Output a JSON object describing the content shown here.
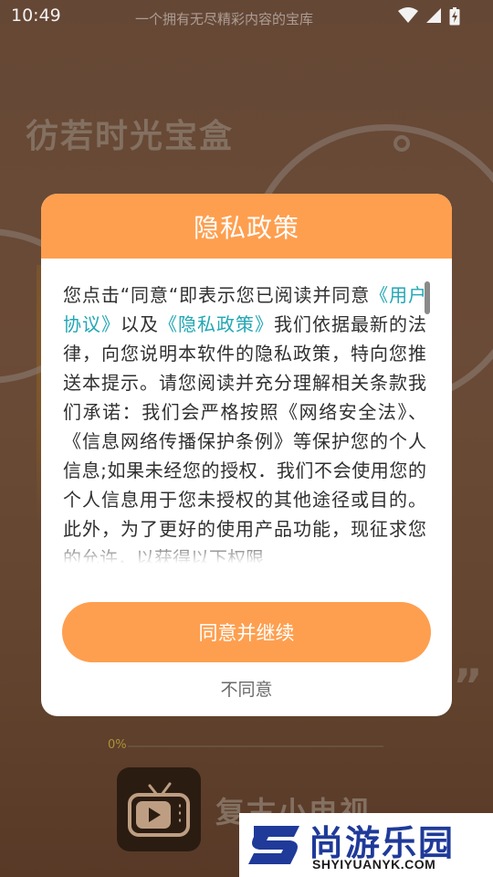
{
  "status_bar": {
    "time": "10:49",
    "center_text": "一个拥有无尽精彩内容的宝库",
    "icons": [
      "wifi-icon",
      "signal-icon",
      "battery-charging-icon"
    ]
  },
  "background": {
    "title": "彷若时光宝盒",
    "quote_mark": "”",
    "progress_label": "0%",
    "progress_value": 0,
    "app_name": "复古小电视",
    "app_icon": "retro-tv-icon"
  },
  "dialog": {
    "title": "隐私政策",
    "body": {
      "t1": "您点击“同意“即表示您已阅读并同意",
      "link1": "《用户协议》",
      "t2": "以及",
      "link2": "《隐私政策》",
      "t3": "我们依据最新的法律，向您说明本软件的隐私政策，特向您推送本提示。请您阅读并充分理解相关条款我们承诺：我们会严格按照《网络安全法》、《信息网络传播保护条例》等保护您的个人信息;如果未经您的授权．我们不会使用您的个人信息用于您未授权的其他途径或目的。此外，为了更好的使用产品功能，现征求您的允许，以获得以下权限"
    },
    "agree_label": "同意并继续",
    "disagree_label": "不同意"
  },
  "watermark": {
    "title": "尚游乐园",
    "url": "SHYIYUANYK.COM"
  },
  "colors": {
    "accent": "#fe9f4f",
    "link": "#22a7b5",
    "watermark_blue": "#1f3a99"
  }
}
